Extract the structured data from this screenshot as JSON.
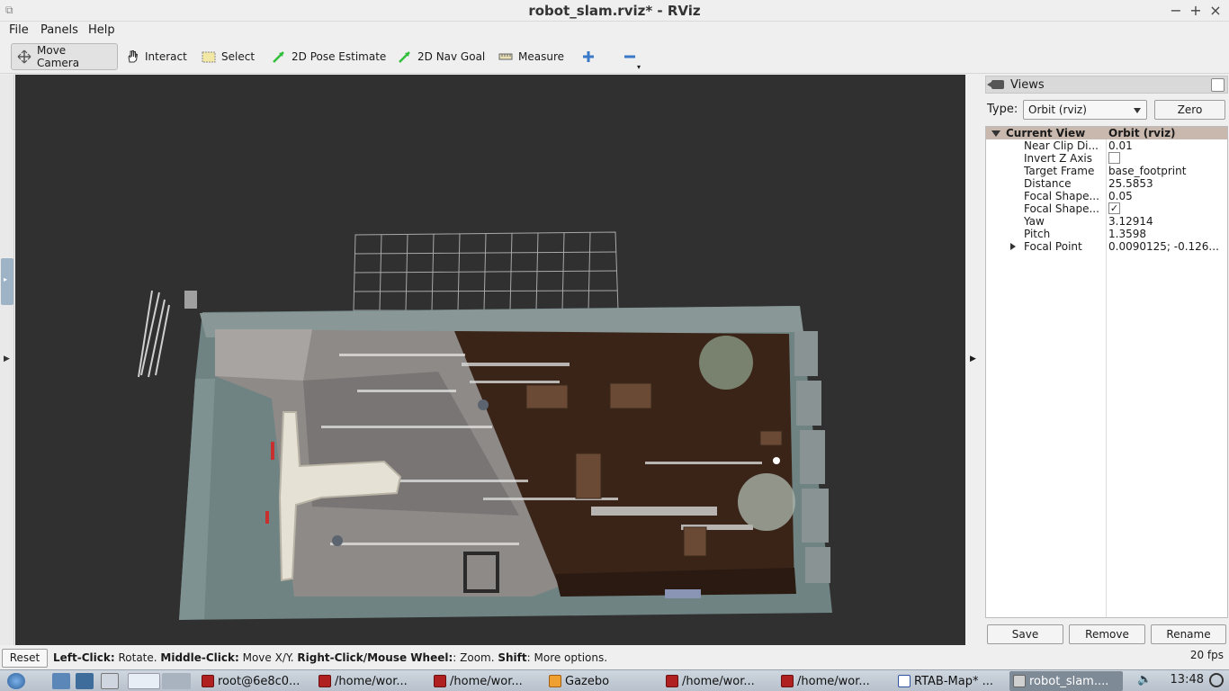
{
  "window": {
    "title": "robot_slam.rviz* - RViz"
  },
  "menu": [
    "File",
    "Panels",
    "Help"
  ],
  "toolbar": {
    "tools": [
      {
        "label": "Move Camera",
        "icon": "move-camera-icon",
        "active": true
      },
      {
        "label": "Interact",
        "icon": "hand-icon"
      },
      {
        "label": "Select",
        "icon": "select-icon"
      },
      {
        "label": "2D Pose Estimate",
        "icon": "green-arrow-icon"
      },
      {
        "label": "2D Nav Goal",
        "icon": "green-arrow-icon"
      },
      {
        "label": "Measure",
        "icon": "ruler-icon"
      }
    ]
  },
  "views_panel": {
    "title": "Views",
    "type_label": "Type:",
    "type_value": "Orbit (rviz)",
    "zero_label": "Zero",
    "tree": {
      "header": {
        "key": "Current View",
        "value": "Orbit (rviz)"
      },
      "rows": [
        {
          "key": "Near Clip Di...",
          "value": "0.01"
        },
        {
          "key": "Invert Z Axis",
          "checkbox": false
        },
        {
          "key": "Target Frame",
          "value": "base_footprint"
        },
        {
          "key": "Distance",
          "value": "25.5853"
        },
        {
          "key": "Focal Shape...",
          "value": "0.05"
        },
        {
          "key": "Focal Shape...",
          "checkbox": true
        },
        {
          "key": "Yaw",
          "value": "3.12914"
        },
        {
          "key": "Pitch",
          "value": "1.3598"
        },
        {
          "key": "Focal Point",
          "value": "0.0090125; -0.126...",
          "expandable": true
        }
      ]
    },
    "buttons": {
      "save": "Save",
      "remove": "Remove",
      "rename": "Rename"
    }
  },
  "status": {
    "reset_label": "Reset",
    "hint_parts": [
      {
        "text": "Left-Click:",
        "bold": true
      },
      {
        "text": " Rotate. ",
        "bold": false
      },
      {
        "text": "Middle-Click:",
        "bold": true
      },
      {
        "text": " Move X/Y. ",
        "bold": false
      },
      {
        "text": "Right-Click/Mouse Wheel:",
        "bold": true
      },
      {
        "text": ": Zoom. ",
        "bold": false
      },
      {
        "text": "Shift",
        "bold": true
      },
      {
        "text": ": More options.",
        "bold": false
      }
    ],
    "fps": "20 fps"
  },
  "taskbar": {
    "tasks": [
      {
        "label": "root@6e8c0...",
        "icon": "terminal-icon"
      },
      {
        "label": "/home/wor...",
        "icon": "terminal-icon"
      },
      {
        "label": "/home/wor...",
        "icon": "terminal-icon"
      },
      {
        "label": "Gazebo",
        "icon": "gazebo-icon"
      },
      {
        "label": "/home/wor...",
        "icon": "terminal-icon"
      },
      {
        "label": "/home/wor...",
        "icon": "terminal-icon"
      },
      {
        "label": "RTAB-Map* ...",
        "icon": "rtabmap-icon"
      },
      {
        "label": "robot_slam....",
        "icon": "rviz-icon",
        "active": true
      }
    ],
    "clock": "13:48"
  },
  "colors": {
    "viewport_bg": "#303030",
    "grid": "#bfbfbf",
    "floor_wood": "#3a2418",
    "floor_grey": "#8a8582",
    "wall": "#6b7b7b"
  }
}
